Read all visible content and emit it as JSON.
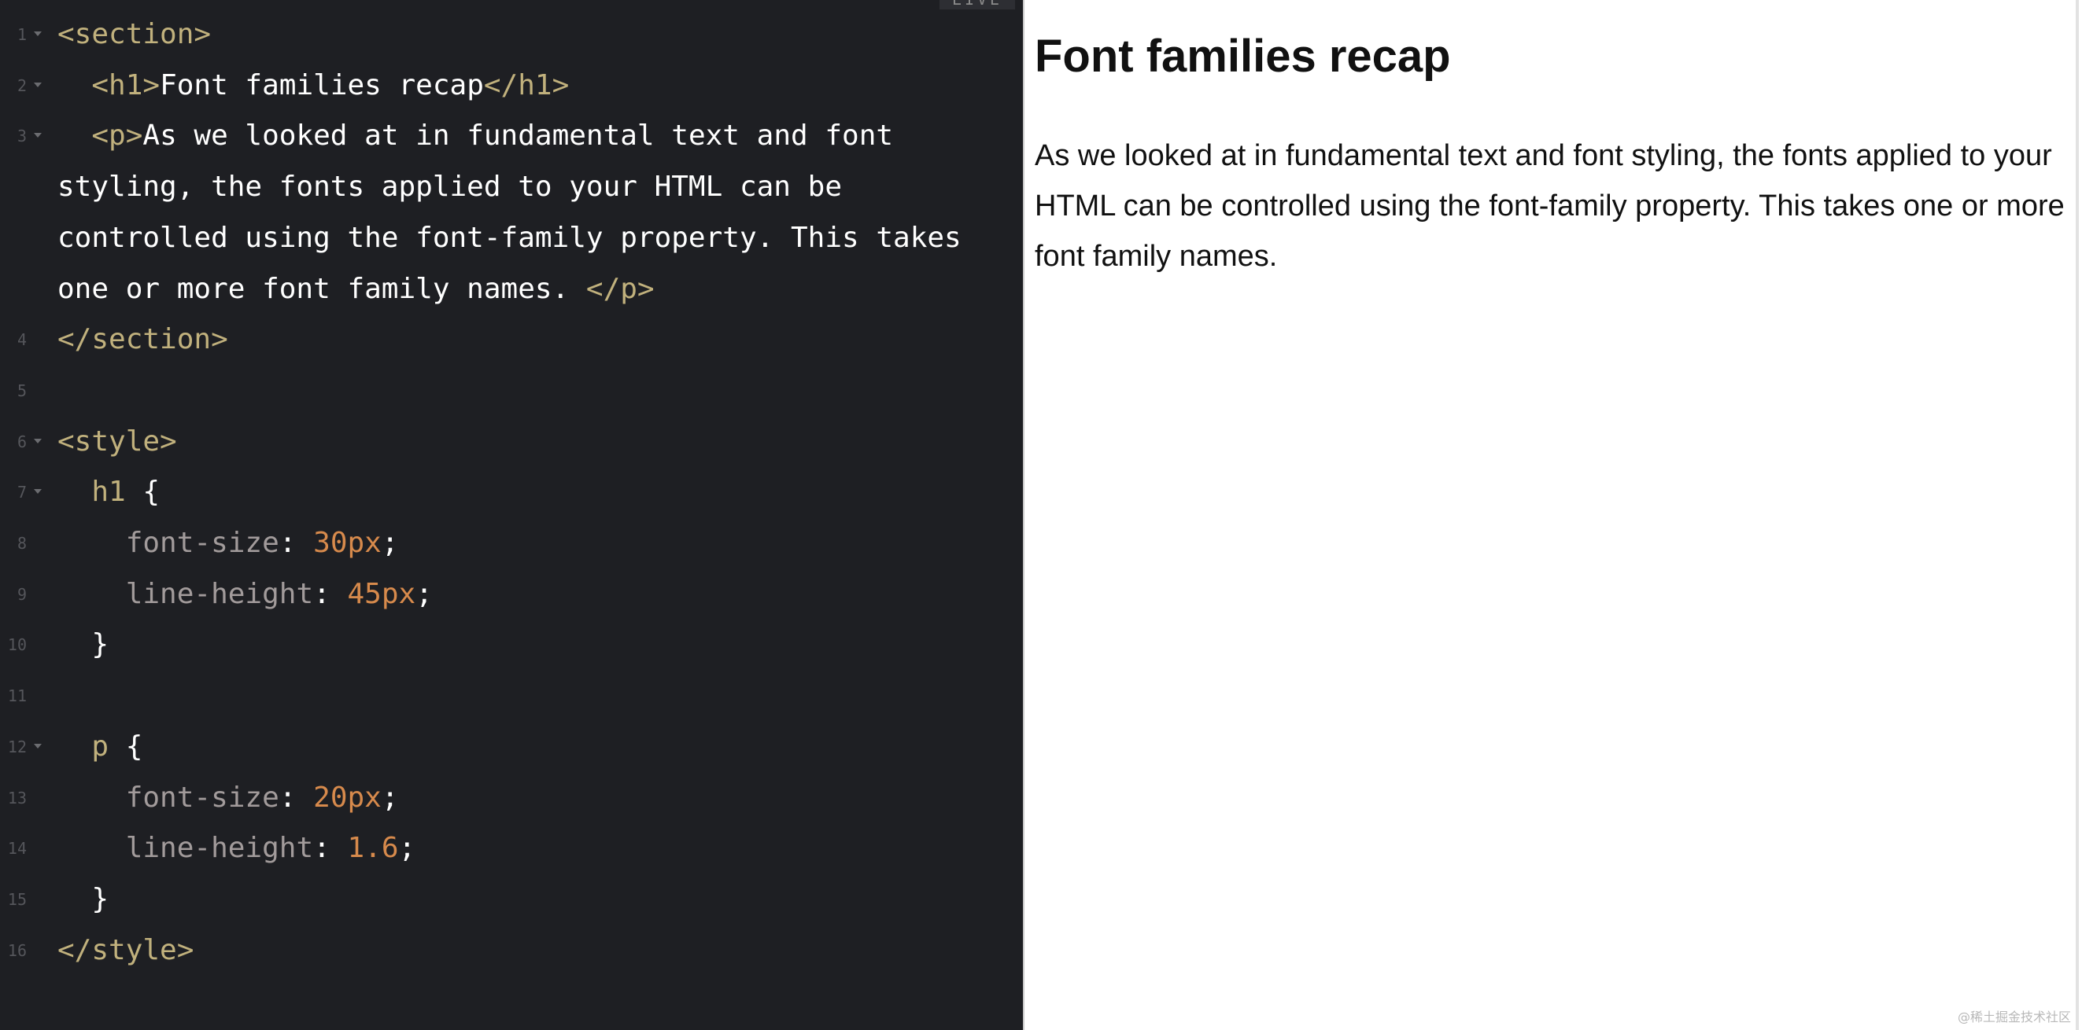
{
  "editor": {
    "tab_label": "LIVE",
    "lines": [
      {
        "num": "1",
        "fold": true,
        "tokens": [
          {
            "t": "<section>",
            "c": "tag"
          }
        ]
      },
      {
        "num": "2",
        "fold": true,
        "tokens": [
          {
            "t": "  ",
            "c": "txt"
          },
          {
            "t": "<h1>",
            "c": "tag"
          },
          {
            "t": "Font families recap",
            "c": "txt"
          },
          {
            "t": "</h1>",
            "c": "tag"
          }
        ]
      },
      {
        "num": "3",
        "fold": true,
        "tokens": [
          {
            "t": "  ",
            "c": "txt"
          },
          {
            "t": "<p>",
            "c": "tag"
          },
          {
            "t": "As we looked at in fundamental text and font",
            "c": "txt"
          }
        ]
      },
      {
        "num": "",
        "fold": false,
        "tokens": [
          {
            "t": "styling, the fonts applied to your HTML can be",
            "c": "txt"
          }
        ]
      },
      {
        "num": "",
        "fold": false,
        "tokens": [
          {
            "t": "controlled using the font-family property. This takes",
            "c": "txt"
          }
        ]
      },
      {
        "num": "",
        "fold": false,
        "tokens": [
          {
            "t": "one or more font family names. ",
            "c": "txt"
          },
          {
            "t": "</p>",
            "c": "tag"
          }
        ]
      },
      {
        "num": "4",
        "fold": false,
        "tokens": [
          {
            "t": "</section>",
            "c": "tag"
          }
        ]
      },
      {
        "num": "5",
        "fold": false,
        "tokens": []
      },
      {
        "num": "6",
        "fold": true,
        "tokens": [
          {
            "t": "<style>",
            "c": "tag"
          }
        ]
      },
      {
        "num": "7",
        "fold": true,
        "tokens": [
          {
            "t": "  ",
            "c": "txt"
          },
          {
            "t": "h1",
            "c": "sel"
          },
          {
            "t": " {",
            "c": "punct"
          }
        ]
      },
      {
        "num": "8",
        "fold": false,
        "tokens": [
          {
            "t": "    ",
            "c": "txt"
          },
          {
            "t": "font-size",
            "c": "prop"
          },
          {
            "t": ": ",
            "c": "punct"
          },
          {
            "t": "30px",
            "c": "num-val"
          },
          {
            "t": ";",
            "c": "punct"
          }
        ]
      },
      {
        "num": "9",
        "fold": false,
        "tokens": [
          {
            "t": "    ",
            "c": "txt"
          },
          {
            "t": "line-height",
            "c": "prop"
          },
          {
            "t": ": ",
            "c": "punct"
          },
          {
            "t": "45px",
            "c": "num-val"
          },
          {
            "t": ";",
            "c": "punct"
          }
        ]
      },
      {
        "num": "10",
        "fold": false,
        "tokens": [
          {
            "t": "  }",
            "c": "punct"
          }
        ]
      },
      {
        "num": "11",
        "fold": false,
        "tokens": []
      },
      {
        "num": "12",
        "fold": true,
        "tokens": [
          {
            "t": "  ",
            "c": "txt"
          },
          {
            "t": "p",
            "c": "sel"
          },
          {
            "t": " {",
            "c": "punct"
          }
        ]
      },
      {
        "num": "13",
        "fold": false,
        "tokens": [
          {
            "t": "    ",
            "c": "txt"
          },
          {
            "t": "font-size",
            "c": "prop"
          },
          {
            "t": ": ",
            "c": "punct"
          },
          {
            "t": "20px",
            "c": "num-val"
          },
          {
            "t": ";",
            "c": "punct"
          }
        ]
      },
      {
        "num": "14",
        "fold": false,
        "tokens": [
          {
            "t": "    ",
            "c": "txt"
          },
          {
            "t": "line-height",
            "c": "prop"
          },
          {
            "t": ": ",
            "c": "punct"
          },
          {
            "t": "1.6",
            "c": "num-val"
          },
          {
            "t": ";",
            "c": "punct"
          }
        ]
      },
      {
        "num": "15",
        "fold": false,
        "tokens": [
          {
            "t": "  }",
            "c": "punct"
          }
        ]
      },
      {
        "num": "16",
        "fold": false,
        "tokens": [
          {
            "t": "</style>",
            "c": "tag"
          }
        ]
      }
    ]
  },
  "preview": {
    "heading": "Font families recap",
    "paragraph": "As we looked at in fundamental text and font styling, the fonts applied to your HTML can be controlled using the font-family property. This takes one or more font family names."
  },
  "watermark": "@稀土掘金技术社区",
  "colors": {
    "editor_bg": "#1e1f23",
    "tag": "#c1b17d",
    "property": "#a29b9b",
    "number": "#d78a4c",
    "text": "#ffffff",
    "gutter": "#55565b"
  }
}
